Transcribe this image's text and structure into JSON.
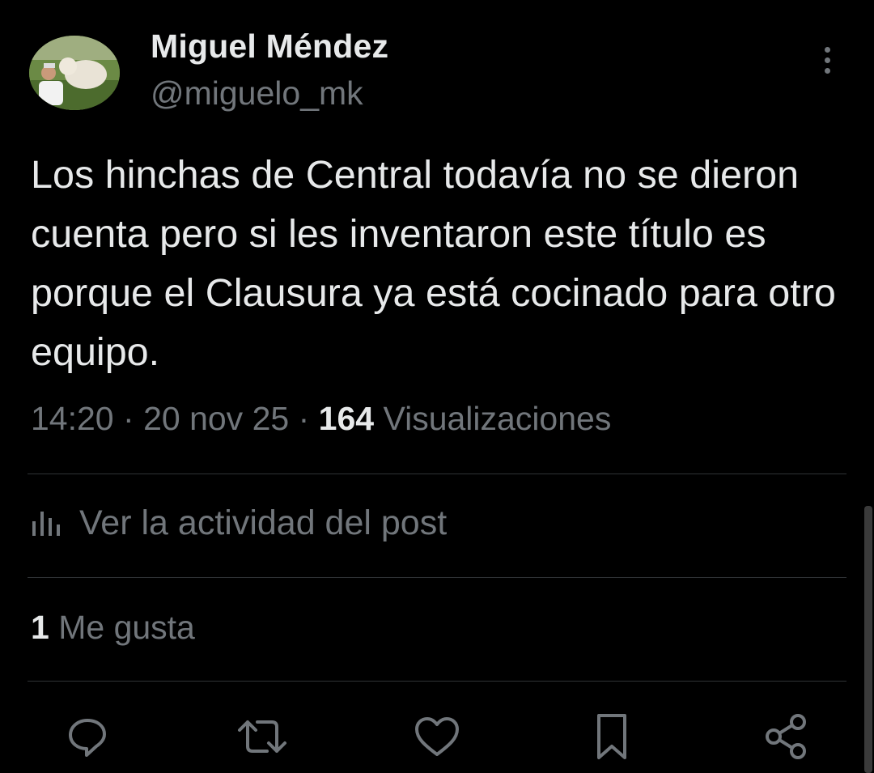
{
  "author": {
    "name": "Miguel Méndez",
    "handle": "@miguelo_mk"
  },
  "tweet": {
    "text": "Los hinchas de Central todavía no se dieron cuenta pero si les inventaron este título es porque el Clausura ya está cocinado para otro equipo.",
    "time": "14:20",
    "date": "20 nov 25",
    "views_count": "164",
    "views_label": "Visualizaciones",
    "separator": "·"
  },
  "activity": {
    "label": "Ver la actividad del post",
    "icon": "analytics-icon"
  },
  "likes": {
    "count": "1",
    "label": "Me gusta"
  },
  "actions": [
    {
      "icon": "reply-icon"
    },
    {
      "icon": "retweet-icon"
    },
    {
      "icon": "like-icon"
    },
    {
      "icon": "bookmark-icon"
    },
    {
      "icon": "share-icon"
    }
  ],
  "colors": {
    "background": "#000000",
    "text_primary": "#e7e9ea",
    "text_secondary": "#71767b",
    "divider": "#2f3336"
  }
}
